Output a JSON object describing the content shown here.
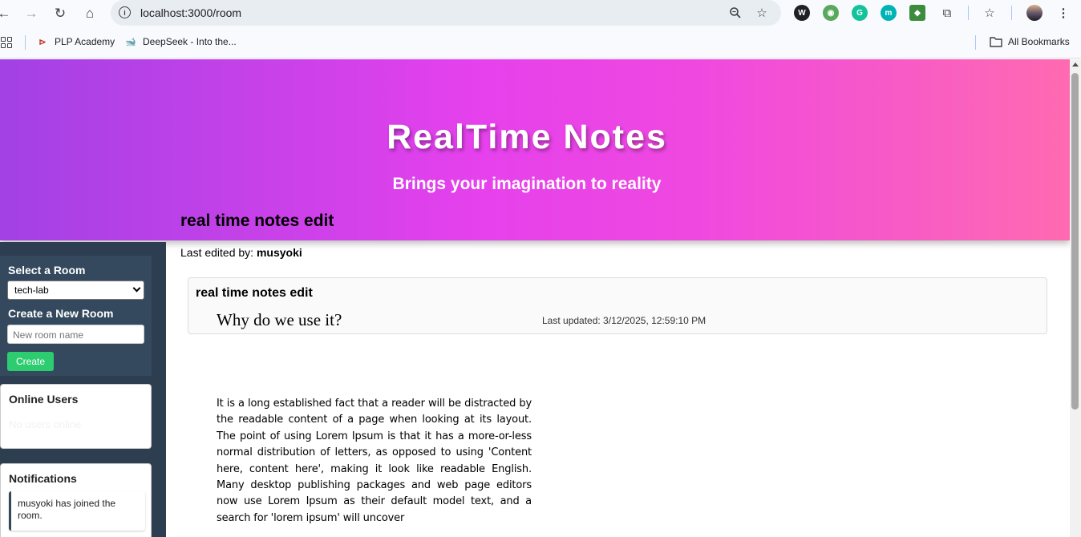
{
  "browser": {
    "url": "localhost:3000/room",
    "bookmarks": [
      {
        "label": "PLP Academy"
      },
      {
        "label": "DeepSeek - Into the..."
      }
    ],
    "all_bookmarks_label": "All Bookmarks"
  },
  "hero": {
    "title": "RealTime Notes",
    "subtitle": "Brings your imagination to reality"
  },
  "sidebar": {
    "select_room_label": "Select a Room",
    "selected_room": "tech-lab",
    "create_room_label": "Create a New Room",
    "new_room_placeholder": "New room name",
    "create_button": "Create",
    "online_users_title": "Online Users",
    "online_users_empty": "No users online",
    "notifications_title": "Notifications",
    "notifications": [
      "musyoki has joined the room."
    ]
  },
  "main": {
    "title": "real time notes edit",
    "last_edited_prefix": "Last edited by:",
    "last_edited_user": "musyoki",
    "note": {
      "title": "real time notes edit",
      "heading": "Why do we use it?",
      "last_updated": "Last updated: 3/12/2025, 12:59:10 PM",
      "body": "It is a long established fact that a reader will be distracted by the readable content of a page when looking at its layout. The point of using Lorem Ipsum is that it has a more-or-less normal distribution of letters, as opposed to using 'Content here, content here', making it look like readable English. Many desktop publishing packages and web page editors now use Lorem Ipsum as their default model text, and a search for 'lorem ipsum' will uncover"
    }
  }
}
